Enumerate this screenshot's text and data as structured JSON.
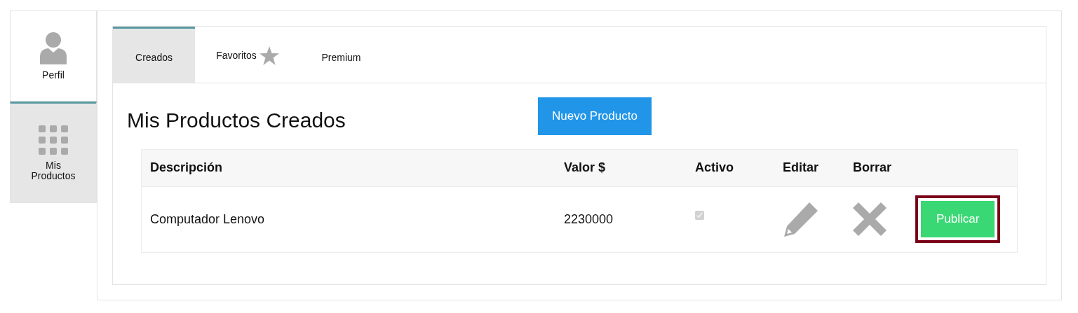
{
  "sidebar": {
    "items": [
      {
        "kind": "profile",
        "label": "Perfil",
        "selected": false
      },
      {
        "kind": "grid",
        "label": "Mis Productos",
        "selected": true
      }
    ]
  },
  "tabs": [
    {
      "label": "Creados",
      "star": false,
      "selected": true
    },
    {
      "label": "Favoritos",
      "star": true,
      "selected": false
    },
    {
      "label": "Premium",
      "star": false,
      "selected": false
    }
  ],
  "heading": "Mis Productos Creados",
  "new_button": "Nuevo Producto",
  "table": {
    "columns": [
      "Descripción",
      "Valor $",
      "Activo",
      "Editar",
      "Borrar"
    ],
    "rows": [
      {
        "description": "Computador Lenovo",
        "value": "2230000",
        "active": true,
        "publish": "Publicar",
        "publish_highlighted": true
      }
    ]
  }
}
